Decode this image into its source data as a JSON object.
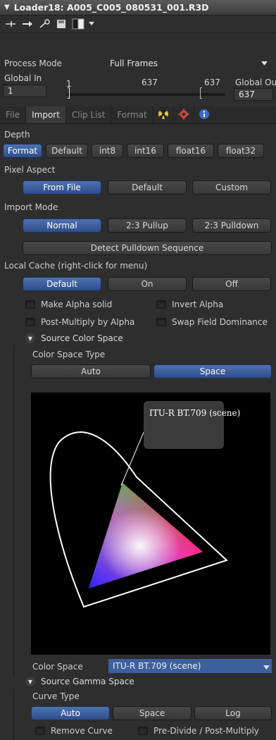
{
  "header": {
    "title": "Loader18: A005_C005_080531_001.R3D"
  },
  "toolbar": {
    "icons": [
      "pin-icon",
      "arrow-right-icon",
      "link-icon",
      "save-icon",
      "color-swatch-icon",
      "dropdown-icon"
    ]
  },
  "process_mode": {
    "label": "Process Mode",
    "value": "Full Frames"
  },
  "global_range": {
    "in_label": "Global In",
    "in_value": "1",
    "range_start": "1",
    "range_mid": "637",
    "range_end": "637",
    "out_label": "Global Out",
    "out_value": "637"
  },
  "tabs": [
    {
      "label": "File"
    },
    {
      "label": "Import",
      "active": true
    },
    {
      "label": "Clip List"
    },
    {
      "label": "Format"
    }
  ],
  "depth": {
    "label": "Depth",
    "options": [
      "Format",
      "Default",
      "int8",
      "int16",
      "float16",
      "float32"
    ],
    "selected": "Format"
  },
  "pixel_aspect": {
    "label": "Pixel Aspect",
    "options": [
      "From File",
      "Default",
      "Custom"
    ],
    "selected": "From File"
  },
  "import_mode": {
    "label": "Import Mode",
    "options": [
      "Normal",
      "2:3 Pullup",
      "2:3 Pulldown"
    ],
    "selected": "Normal"
  },
  "detect_pulldown": {
    "label": "Detect Pulldown Sequence"
  },
  "local_cache": {
    "label": "Local Cache (right-click for menu)",
    "options": [
      "Default",
      "On",
      "Off"
    ],
    "selected": "Default"
  },
  "checkboxes": [
    {
      "label": "Make Alpha solid"
    },
    {
      "label": "Invert Alpha"
    },
    {
      "label": "Post-Multiply by Alpha"
    },
    {
      "label": "Swap Field Dominance"
    }
  ],
  "source_color_space": {
    "label": "Source Color Space",
    "type_label": "Color Space Type",
    "type_options": [
      "Auto",
      "Space"
    ],
    "type_selected": "Space",
    "chart_tooltip": "ITU-R BT.709 (scene)",
    "color_space_label": "Color Space",
    "color_space_value": "ITU-R BT.709 (scene)"
  },
  "source_gamma_space": {
    "label": "Source Gamma Space",
    "curve_label": "Curve Type",
    "curve_options": [
      "Auto",
      "Space",
      "Log"
    ],
    "curve_selected": "Auto",
    "remove_curve": "Remove Curve",
    "pre_divide": "Pre-Divide / Post-Multiply"
  },
  "colors": {
    "accent": "#3d5f9e",
    "panel": "#2e2e2e"
  }
}
